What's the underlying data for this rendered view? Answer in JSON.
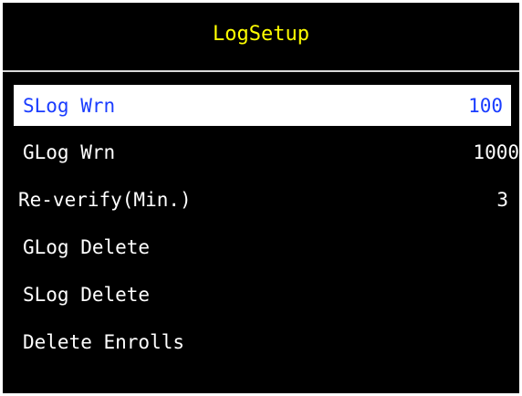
{
  "header": {
    "title": "LogSetup"
  },
  "colors": {
    "background": "#000000",
    "title_text": "#ffff00",
    "selected_bg": "#ffffff",
    "selected_text": "#1a3cff",
    "item_text": "#ffffff",
    "divider": "#d9d9d9"
  },
  "menu": {
    "items": [
      {
        "label": "SLog Wrn",
        "value": "100",
        "selected": true
      },
      {
        "label": "GLog Wrn",
        "value": "1000",
        "selected": false
      },
      {
        "label": "Re-verify(Min.)",
        "value": "3",
        "selected": false
      },
      {
        "label": "GLog Delete",
        "value": "",
        "selected": false
      },
      {
        "label": "SLog Delete",
        "value": "",
        "selected": false
      },
      {
        "label": "Delete Enrolls",
        "value": "",
        "selected": false
      }
    ]
  }
}
